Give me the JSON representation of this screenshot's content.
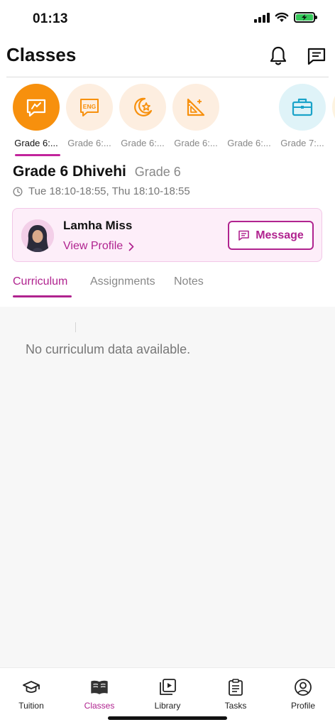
{
  "status_bar": {
    "time": "01:13"
  },
  "header": {
    "title": "Classes"
  },
  "class_strip": [
    {
      "label": "Grade 6:...",
      "icon": "presentation-icon",
      "active": true
    },
    {
      "label": "Grade 6:...",
      "icon": "eng-icon",
      "active": false
    },
    {
      "label": "Grade 6:...",
      "icon": "crescent-star-icon",
      "active": false
    },
    {
      "label": "Grade 6:...",
      "icon": "geometry-icon",
      "active": false
    },
    {
      "label": "Grade 6:...",
      "icon": "",
      "active": false
    },
    {
      "label": "Grade 7:...",
      "icon": "briefcase-icon",
      "active": false
    }
  ],
  "class_detail": {
    "name": "Grade 6 Dhivehi",
    "grade": "Grade 6",
    "schedule": "Tue 18:10-18:55, Thu 18:10-18:55"
  },
  "teacher": {
    "name": "Lamha Miss",
    "view_profile": "View Profile",
    "message_label": "Message"
  },
  "tabs": [
    {
      "label": "Curriculum",
      "active": true
    },
    {
      "label": "Assignments",
      "active": false
    },
    {
      "label": "Notes",
      "active": false
    }
  ],
  "content": {
    "empty_message": "No curriculum data available."
  },
  "bottom_nav": [
    {
      "label": "Tuition",
      "icon": "graduation-cap-icon",
      "active": false
    },
    {
      "label": "Classes",
      "icon": "open-book-icon",
      "active": true
    },
    {
      "label": "Library",
      "icon": "video-library-icon",
      "active": false
    },
    {
      "label": "Tasks",
      "icon": "clipboard-icon",
      "active": false
    },
    {
      "label": "Profile",
      "icon": "user-circle-icon",
      "active": false
    }
  ],
  "colors": {
    "accent": "#b0238f",
    "active_class": "#f7900d",
    "class_bg": "#fdeee0",
    "teal_class_bg": "#dff3f8",
    "card_bg": "#fdeef9"
  }
}
